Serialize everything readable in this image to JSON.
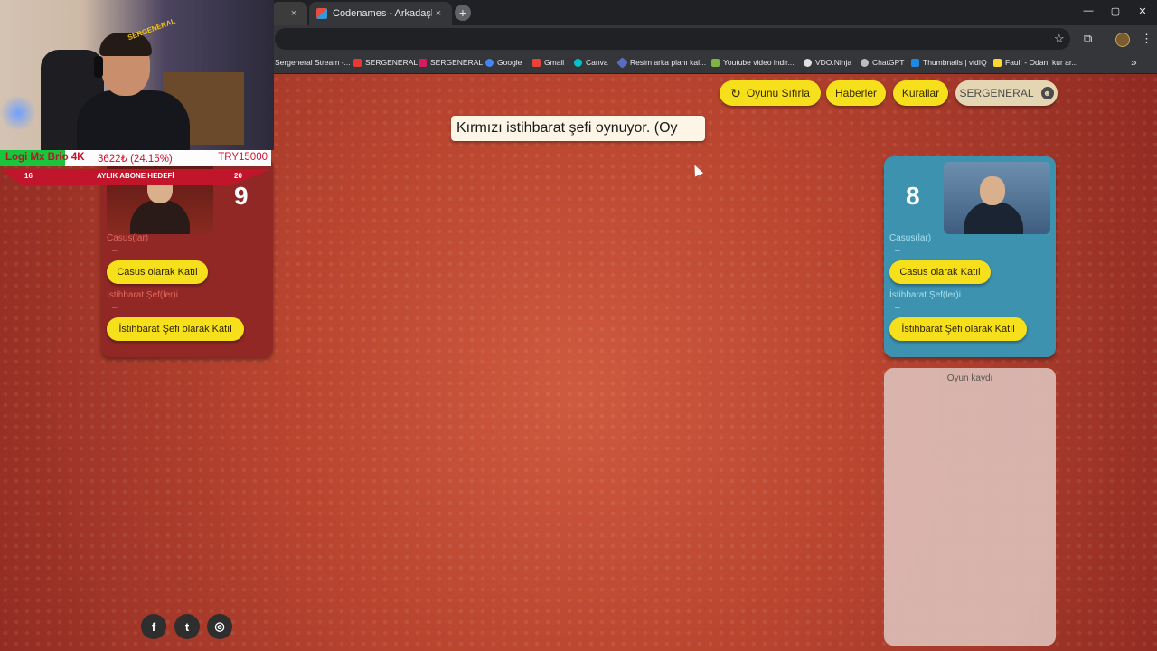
{
  "browser": {
    "tabs": [
      {
        "title": "",
        "close": "×"
      },
      {
        "title": "Codenames - Arkadaşlarınızla ç",
        "close": "×"
      }
    ],
    "new_tab": "+",
    "window_controls": {
      "minimize": "—",
      "maximize": "▢",
      "close": "✕"
    },
    "toolbar_icons": {
      "star": "☆",
      "extensions": "⧉",
      "menu": "⋮"
    },
    "bookmarks": [
      {
        "label": "Sergeneral Stream -...",
        "icon_color": "#8e44ad"
      },
      {
        "label": "SERGENERAL",
        "icon_color": "#e53935"
      },
      {
        "label": "SERGENERAL",
        "icon_color": "#d81b60"
      },
      {
        "label": "Google",
        "icon_color": "#4285f4"
      },
      {
        "label": "Gmail",
        "icon_color": "#ea4335"
      },
      {
        "label": "Canva",
        "icon_color": "#00c4cc"
      },
      {
        "label": "Resim arka planı kal...",
        "icon_color": "#5c6bc0"
      },
      {
        "label": "Youtube video indir...",
        "icon_color": "#7cb342"
      },
      {
        "label": "VDO.Ninja",
        "icon_color": "#e0e0e0"
      },
      {
        "label": "ChatGPT",
        "icon_color": "#bdbdbd"
      },
      {
        "label": "Thumbnails | vidIQ",
        "icon_color": "#1e88e5"
      },
      {
        "label": "Faul! - Odanı kur ar...",
        "icon_color": "#fdd835"
      }
    ],
    "bookmarks_more": "»"
  },
  "header": {
    "reset_label": "Oyunu Sıfırla",
    "reset_icon": "↻",
    "news_label": "Haberler",
    "rules_label": "Kurallar",
    "user_label": "SERGENERAL",
    "user_icon": "☻"
  },
  "status_text": "Kırmızı istihbarat şefi oynuyor. (Oy",
  "teams": {
    "red": {
      "score": "9",
      "operatives_label": "Casus(lar)",
      "operatives_value": "–",
      "join_operative": "Casus olarak Katıl",
      "spymasters_label": "İstihbarat Şef(ler)i",
      "spymasters_value": "–",
      "join_spymaster": "İstihbarat Şefi olarak Katıl",
      "color": "#912826"
    },
    "blue": {
      "score": "8",
      "operatives_label": "Casus(lar)",
      "operatives_value": "–",
      "join_operative": "Casus olarak Katıl",
      "spymasters_label": "İstihbarat Şef(ler)i",
      "spymasters_value": "–",
      "join_spymaster": "İstihbarat Şefi olarak Katıl",
      "color": "#3d92b0"
    }
  },
  "log": {
    "title": "Oyun kaydı"
  },
  "social": {
    "facebook": "f",
    "twitter": "t",
    "instagram": "◎"
  },
  "overlay": {
    "webcam_logo": "SERGENERAL",
    "donation": {
      "name": "Logi Mx Brio 4K",
      "current": "3622₺ (24.15%)",
      "target": "TRY15000",
      "progress": 0.2415
    },
    "sub_goal": {
      "left": "16",
      "title": "AYLIK ABONE HEDEFİ",
      "right": "20"
    }
  }
}
